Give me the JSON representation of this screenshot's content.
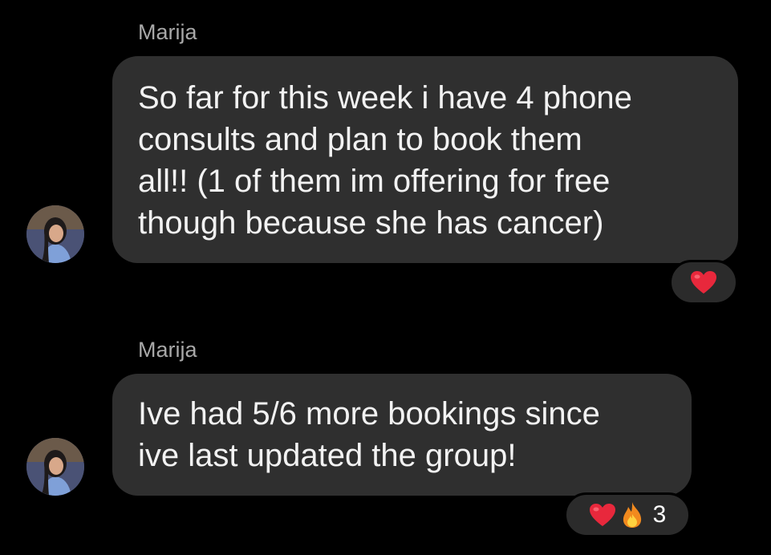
{
  "messages": [
    {
      "sender": "Marija",
      "text": "So far for this week i have 4 phone\nconsults and plan to book them\nall!! (1 of them im offering for free\nthough because she has cancer)",
      "reactions": {
        "icons": [
          "heart-icon"
        ],
        "count": ""
      }
    },
    {
      "sender": "Marija",
      "text": "Ive had 5/6 more bookings since\nive last updated the group!",
      "reactions": {
        "icons": [
          "heart-icon",
          "fire-icon"
        ],
        "count": "3"
      }
    }
  ],
  "colors": {
    "background": "#000000",
    "bubble": "#2f2f2f",
    "sender_name": "#a8a8a8",
    "heart": "#e8283c",
    "fire": "#f5a623"
  }
}
